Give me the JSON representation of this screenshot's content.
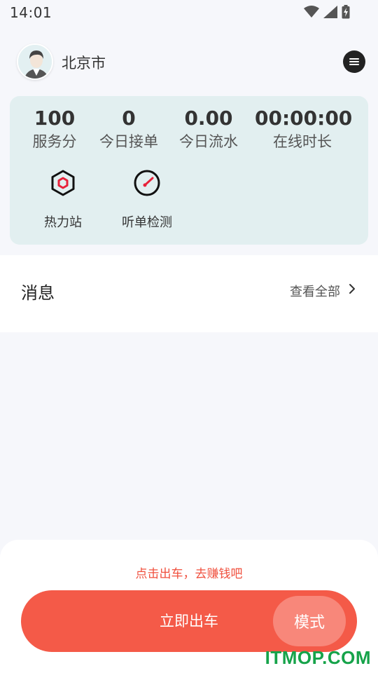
{
  "status_bar": {
    "time": "14:01"
  },
  "header": {
    "city": "北京市"
  },
  "stats": [
    {
      "value": "100",
      "label": "服务分"
    },
    {
      "value": "0",
      "label": "今日接单"
    },
    {
      "value": "0.00",
      "label": "今日流水"
    },
    {
      "value": "00:00:00",
      "label": "在线时长"
    }
  ],
  "tools": [
    {
      "label": "热力站",
      "icon": "hexagon-icon"
    },
    {
      "label": "听单检测",
      "icon": "gauge-icon"
    }
  ],
  "messages": {
    "title": "消息",
    "view_all": "查看全部"
  },
  "bottom": {
    "hint": "点击出车，去赚钱吧",
    "go_label": "立即出车",
    "mode_label": "模式"
  },
  "watermark": "ITMOP.COM",
  "colors": {
    "accent": "#f45a48",
    "card_bg": "#e2eff0",
    "hint": "#f0503e"
  }
}
